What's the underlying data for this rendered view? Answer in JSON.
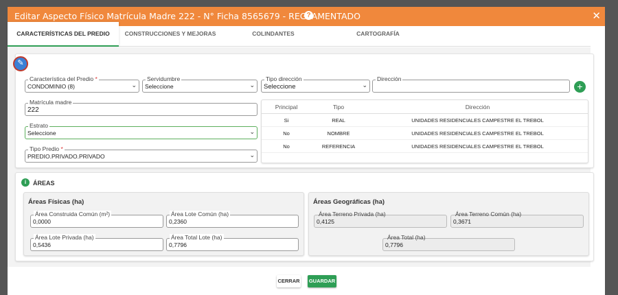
{
  "header": {
    "title": "Editar Aspecto Físico Matrícula Madre 222 - N° Ficha 8565679 - REGLAMENTADO",
    "help_icon": "?",
    "close_icon": "✕"
  },
  "tabs": [
    {
      "label": "CARACTERÍSTICAS DEL PREDIO",
      "active": true
    },
    {
      "label": "CONSTRUCCIONES Y MEJORAS",
      "active": false
    },
    {
      "label": "COLINDANTES",
      "active": false
    },
    {
      "label": "CARTOGRAFÍA",
      "active": false
    }
  ],
  "form": {
    "caracteristica": {
      "label": "Característica del Predio",
      "required": "*",
      "value": "CONDOMINIO (8)"
    },
    "servidumbre": {
      "label": "Servidumbre",
      "value": "Seleccione"
    },
    "tipo_direccion": {
      "label": "Tipo dirección",
      "value": "Seleccione"
    },
    "direccion": {
      "label": "Dirección",
      "value": ""
    },
    "matricula": {
      "label": "Matrícula madre",
      "value": "222"
    },
    "estrato": {
      "label": "Estrato",
      "value": "Seleccione"
    },
    "tipo_predio": {
      "label": "Tipo Predio",
      "required": "*",
      "value": "PREDIO.PRIVADO.PRIVADO"
    }
  },
  "address_table": {
    "headers": [
      "Principal",
      "Tipo",
      "Dirección"
    ],
    "rows": [
      [
        "Si",
        "REAL",
        "UNIDADES RESIDENCIALES CAMPESTRE EL TREBOL"
      ],
      [
        "No",
        "NOMBRE",
        "UNIDADES RESIDENCIALES CAMPESTRE EL TREBOL"
      ],
      [
        "No",
        "REFERENCIA",
        "UNIDADES RESIDENCIALES CAMPESTRE EL TREBOL"
      ]
    ]
  },
  "areas": {
    "title": "ÁREAS",
    "fisicas": {
      "title": "Áreas Físicas (ha)",
      "construida_comun": {
        "label": "Área Construida Común (m²)",
        "value": "0,0000"
      },
      "lote_comun": {
        "label": "Área Lote Común (ha)",
        "value": "0,2360"
      },
      "lote_privada": {
        "label": "Área Lote Privada (ha)",
        "value": "0,5436"
      },
      "total_lote": {
        "label": "Área Total Lote (ha)",
        "value": "0,7796"
      }
    },
    "geograficas": {
      "title": "Áreas Geográficas (ha)",
      "terreno_privada": {
        "label": "Área Terreno Privada (ha)",
        "value": "0,4125"
      },
      "terreno_comun": {
        "label": "Área Terreno Común (ha)",
        "value": "0,3671"
      },
      "total": {
        "label": "Área Total (ha)",
        "value": "0,7796"
      }
    }
  },
  "footer": {
    "cancel": "CERRAR",
    "save": "GUARDAR"
  },
  "colors": {
    "header": "#f0883c",
    "accent": "#2e9e55",
    "edit": "#3a7fd5"
  },
  "icons": {
    "edit": "pencil-icon",
    "add": "plus-icon",
    "info": "info-icon",
    "chevron": "chevron-down-icon"
  }
}
